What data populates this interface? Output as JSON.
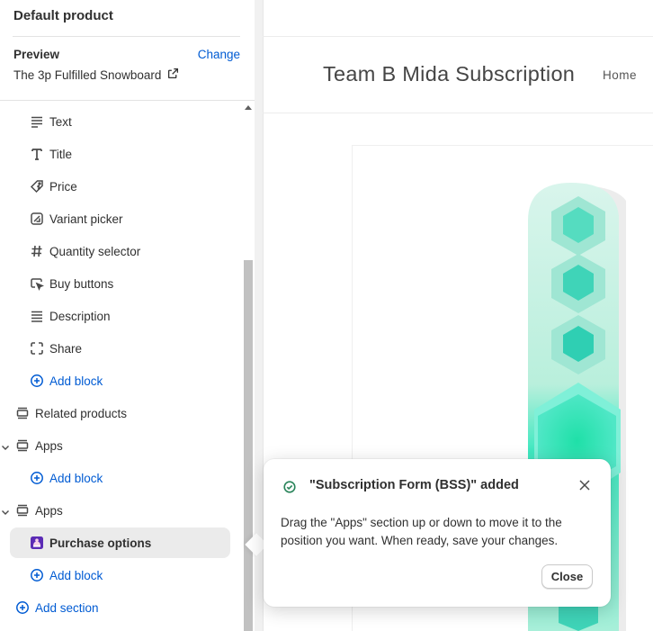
{
  "sidebar": {
    "title": "Default product",
    "preview_label": "Preview",
    "change_label": "Change",
    "product_name": "The 3p Fulfilled Snowboard",
    "blocks": [
      {
        "label": "Text",
        "icon": "text-icon"
      },
      {
        "label": "Title",
        "icon": "title-icon"
      },
      {
        "label": "Price",
        "icon": "price-tag-icon"
      },
      {
        "label": "Variant picker",
        "icon": "variant-picker-icon"
      },
      {
        "label": "Quantity selector",
        "icon": "hashtag-icon"
      },
      {
        "label": "Buy buttons",
        "icon": "cursor-click-icon"
      },
      {
        "label": "Description",
        "icon": "text-lines-icon"
      },
      {
        "label": "Share",
        "icon": "share-icon"
      }
    ],
    "add_block_label": "Add block",
    "sections": [
      {
        "label": "Related products",
        "icon": "section-icon"
      },
      {
        "label": "Apps",
        "icon": "section-icon"
      },
      {
        "label": "Apps",
        "icon": "section-icon"
      }
    ],
    "app_block": {
      "label": "Purchase options",
      "icon": "app-logo-icon"
    },
    "add_section_label": "Add section",
    "accent_color": "#005bd3"
  },
  "preview": {
    "store_name": "Team B Mida Subscription",
    "nav_home": "Home"
  },
  "popover": {
    "title": "\"Subscription Form (BSS)\" added",
    "message": "Drag the \"Apps\" section up or down to move it to the position you want. When ready, save your changes.",
    "close_button": "Close",
    "success_color": "#29845a"
  }
}
